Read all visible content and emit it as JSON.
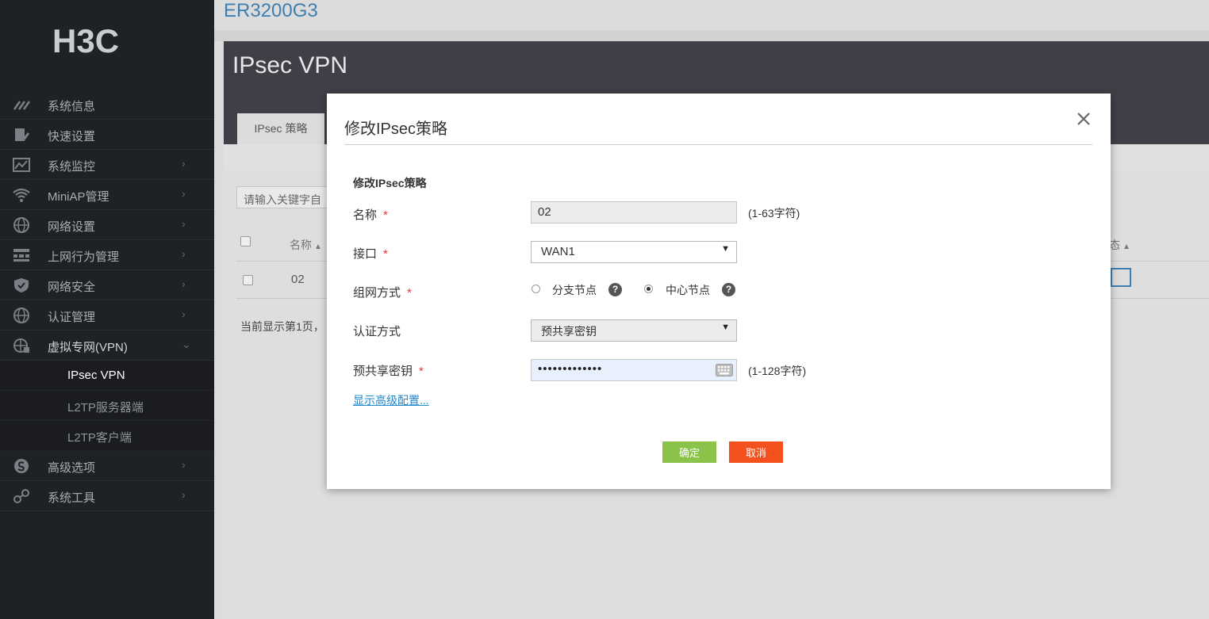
{
  "brand": {
    "logo_text": "H3C"
  },
  "sidebar": {
    "items": [
      {
        "label": "系统信息",
        "icon": "gauge-icon",
        "chevron": false
      },
      {
        "label": "快速设置",
        "icon": "document-edit-icon",
        "chevron": false
      },
      {
        "label": "系统监控",
        "icon": "monitor-chart-icon",
        "chevron": true
      },
      {
        "label": "MiniAP管理",
        "icon": "wifi-icon",
        "chevron": true
      },
      {
        "label": "网络设置",
        "icon": "globe-icon",
        "chevron": true
      },
      {
        "label": "上网行为管理",
        "icon": "network-grid-icon",
        "chevron": true
      },
      {
        "label": "网络安全",
        "icon": "shield-icon",
        "chevron": true
      },
      {
        "label": "认证管理",
        "icon": "globe-icon",
        "chevron": true
      },
      {
        "label": "虚拟专网(VPN)",
        "icon": "globe-vpn-icon",
        "chevron": true,
        "open": true
      }
    ],
    "sub_items": [
      {
        "label": "IPsec VPN",
        "active": true
      },
      {
        "label": "L2TP服务器端",
        "active": false
      },
      {
        "label": "L2TP客户端",
        "active": false
      }
    ],
    "bottom_items": [
      {
        "label": "高级选项",
        "icon": "globe-s-icon",
        "chevron": true
      },
      {
        "label": "系统工具",
        "icon": "link-tool-icon",
        "chevron": true
      }
    ],
    "chevron_right": "›",
    "chevron_down": "⌄"
  },
  "main": {
    "device_title": "ER3200G3",
    "page_title": "IPsec VPN",
    "tab_label": "IPsec 策略",
    "search_placeholder": "请输入关键字自",
    "table": {
      "col_name": "名称",
      "col_state": "态",
      "sort_glyph": "▲",
      "rows": [
        {
          "name": "02"
        }
      ]
    },
    "pager_text": "当前显示第1页，"
  },
  "modal": {
    "title": "修改IPsec策略",
    "close_glyph": "✕",
    "section_title": "修改IPsec策略",
    "fields": {
      "name": {
        "label": "名称",
        "value": "02",
        "hint": "(1-63字符)"
      },
      "interface": {
        "label": "接口",
        "value": "WAN1"
      },
      "network_mode": {
        "label": "组网方式",
        "options": [
          {
            "label": "分支节点",
            "selected": false
          },
          {
            "label": "中心节点",
            "selected": true
          }
        ]
      },
      "auth_method": {
        "label": "认证方式",
        "value": "预共享密钥"
      },
      "psk": {
        "label": "预共享密钥",
        "value": "•••••••••••••",
        "hint": "(1-128字符)"
      }
    },
    "required_mark": "*",
    "help_glyph": "?",
    "advanced_link": "显示高级配置...",
    "buttons": {
      "ok": "确定",
      "cancel": "取消"
    }
  },
  "colors": {
    "sidebar_bg": "#1f2225",
    "header_bg": "#3f4047",
    "title_blue": "#3f7fb0",
    "ok_green": "#8bc34a",
    "cancel_red": "#f4511e",
    "link_blue": "#1e88d0",
    "required_red": "#e53935"
  }
}
